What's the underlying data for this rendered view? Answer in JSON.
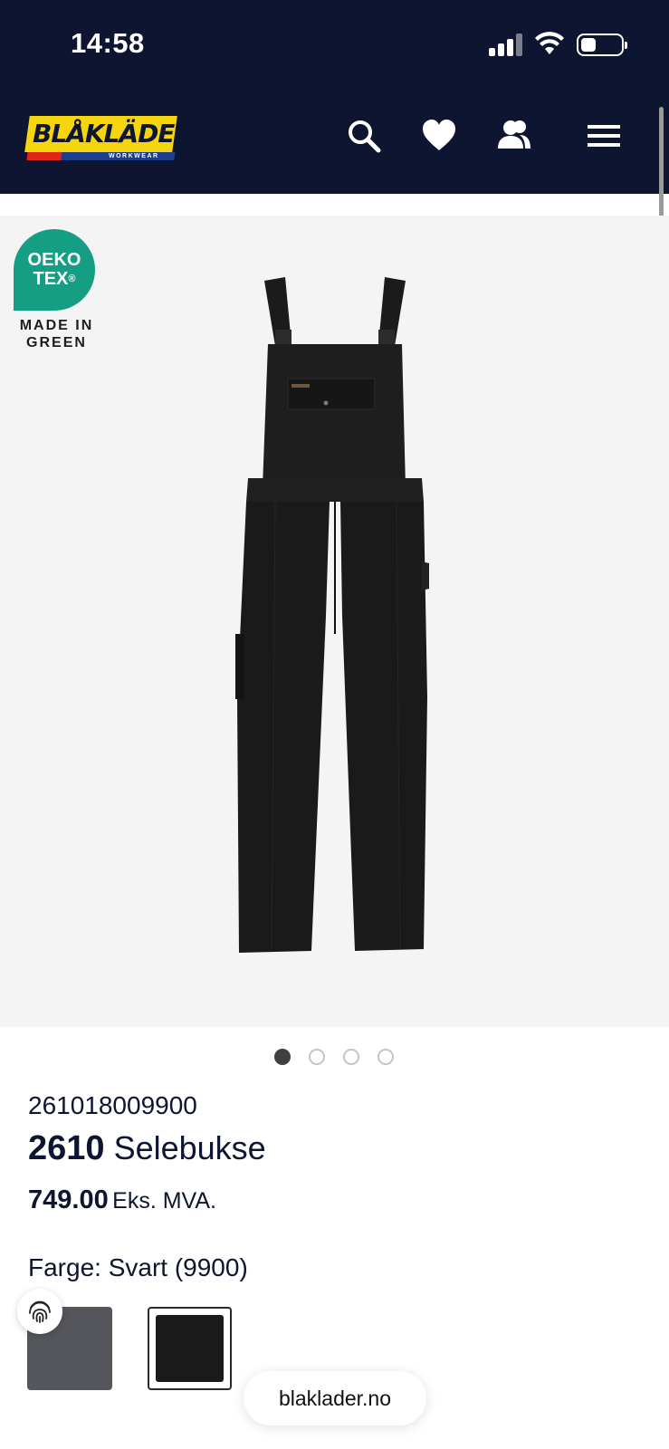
{
  "status_bar": {
    "time": "14:58"
  },
  "header": {
    "logo_text": "BLÅKLÄDER",
    "logo_subtext": "WORKWEAR",
    "icons": [
      "search-icon",
      "heart-icon",
      "account-icon",
      "menu-icon"
    ]
  },
  "badge": {
    "oeko_line1": "OEKO",
    "oeko_line2": "TEX",
    "oeko_mark": "®",
    "made_in_green": "MADE IN GREEN"
  },
  "carousel": {
    "total": 4,
    "active": 1
  },
  "product": {
    "sku": "261018009900",
    "model": "2610",
    "name": "Selebukse",
    "price": "749.00",
    "price_suffix": "Eks. MVA.",
    "color_label": "Farge: Svart (9900)"
  },
  "swatches": [
    {
      "color": "#54565b",
      "selected": false
    },
    {
      "color": "#1a1a1a",
      "selected": true
    }
  ],
  "browser": {
    "url": "blaklader.no"
  },
  "colors": {
    "header_bg": "#0d1530",
    "logo_yellow": "#f5d60e",
    "oeko_green": "#159e84"
  }
}
